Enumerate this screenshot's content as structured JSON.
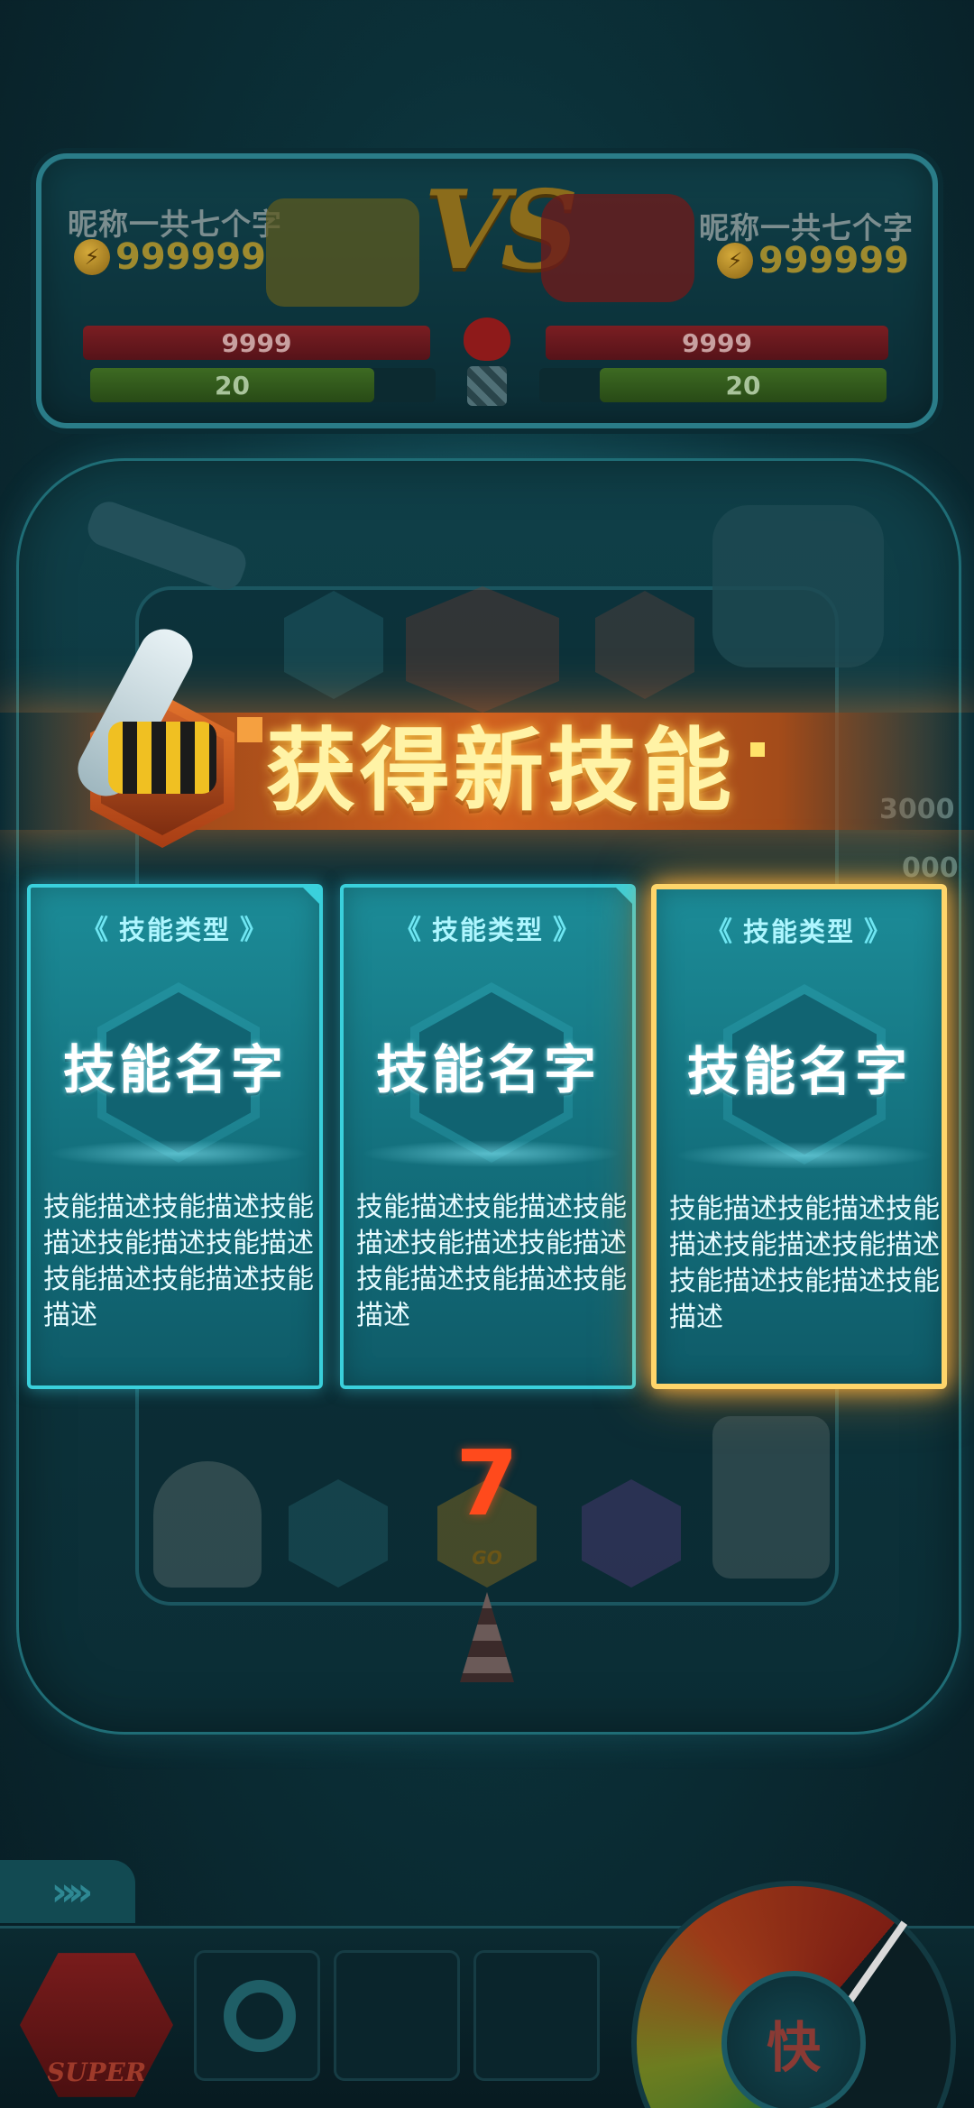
{
  "players": {
    "left": {
      "name": "昵称一共七个字",
      "coins": "999999",
      "hp": "9999",
      "energy": "20"
    },
    "right": {
      "name": "昵称一共七个字",
      "coins": "999999",
      "hp": "9999",
      "energy": "20"
    }
  },
  "vs_label": "VS",
  "banner": {
    "title": "获得新技能"
  },
  "side_scores": [
    "3000",
    "000"
  ],
  "cards": [
    {
      "type": "技能类型",
      "name": "技能名字",
      "description": "技能描述技能描述技能描述技能描述技能描述技能描述技能描述技能描述",
      "selected": false
    },
    {
      "type": "技能类型",
      "name": "技能名字",
      "description": "技能描述技能描述技能描述技能描述技能描述技能描述技能描述技能描述",
      "selected": false
    },
    {
      "type": "技能类型",
      "name": "技能名字",
      "description": "技能描述技能描述技能描述技能描述技能描述技能描述技能描述技能描述",
      "selected": true
    }
  ],
  "countdown": "7",
  "hud": {
    "super_label": "SUPER",
    "speed_label": "快",
    "go_label": "GO"
  },
  "colors": {
    "accent_cyan": "#3ad0dc",
    "selected_gold": "#ffd56a",
    "banner_orange": "#dc641e",
    "countdown_red": "#ff4a1c"
  }
}
